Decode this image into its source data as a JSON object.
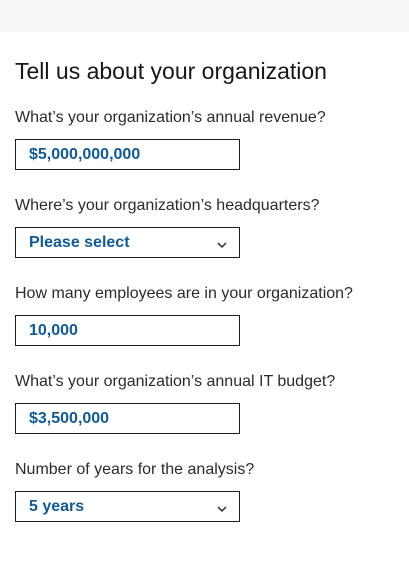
{
  "form": {
    "title": "Tell us about your organization",
    "revenue": {
      "label": "What’s your organization’s annual revenue?",
      "value": "$5,000,000,000"
    },
    "headquarters": {
      "label": "Where’s your organization’s headquarters?",
      "value": "Please select",
      "icon": "chevron-down-icon"
    },
    "employees": {
      "label": "How many employees are in your organization?",
      "value": "10,000"
    },
    "it_budget": {
      "label": "What’s your organization’s annual IT budget?",
      "value": "$3,500,000"
    },
    "years": {
      "label": "Number of years for the analysis?",
      "value": "5 years",
      "icon": "chevron-down-icon"
    }
  },
  "colors": {
    "value_text": "#0f5b98",
    "border": "#1f1f1f",
    "top_strip": "#f7f7f8"
  }
}
